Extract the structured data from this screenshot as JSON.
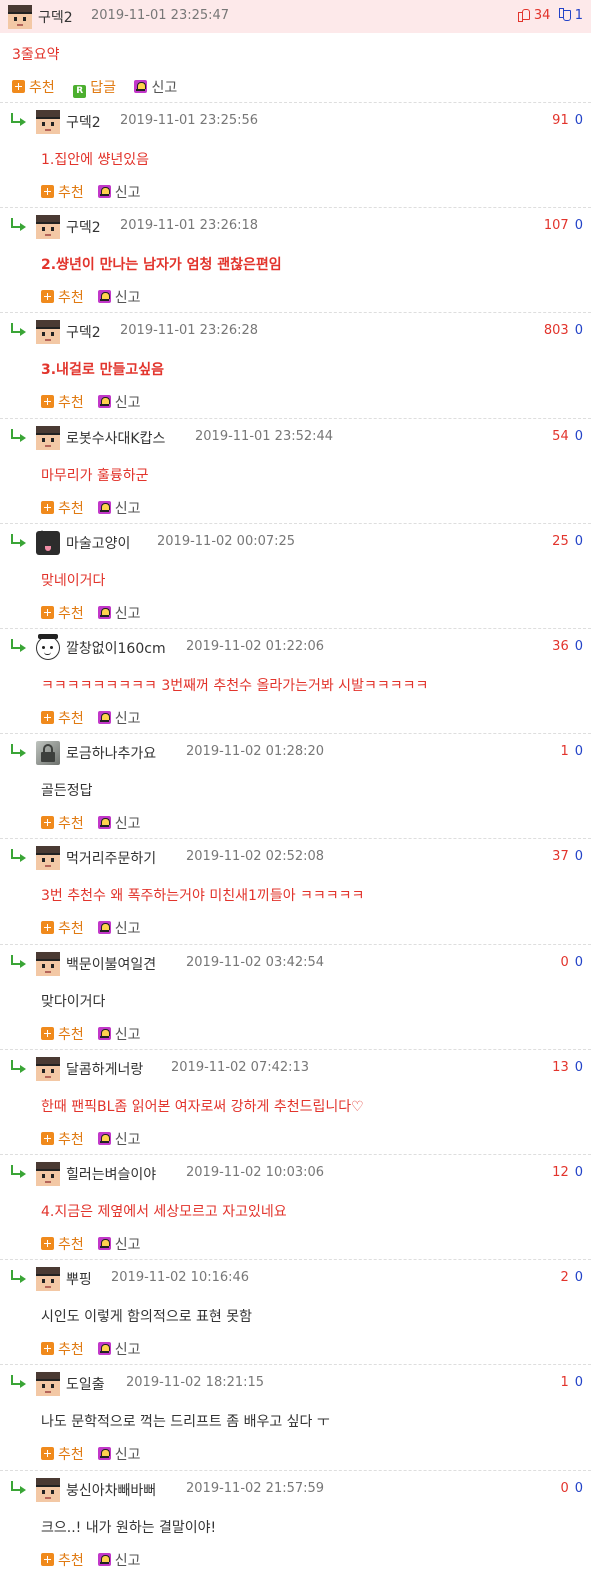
{
  "top": {
    "nick": "구덱2",
    "date": "2019-11-01 23:25:47",
    "up": "34",
    "down": "1",
    "text": "3줄요약",
    "actions": {
      "recommend": "추천",
      "reply": "답글",
      "reply_badge": "R",
      "report": "신고"
    }
  },
  "labels": {
    "recommend": "추천",
    "report": "신고"
  },
  "replies": [
    {
      "nick": "구덱2",
      "date": "2019-11-01 23:25:56",
      "up": "91",
      "down": "0",
      "text": "1.집안에 썅년있음",
      "avatar": "pixel-avatar",
      "style": "red"
    },
    {
      "nick": "구덱2",
      "date": "2019-11-01 23:26:18",
      "up": "107",
      "down": "0",
      "text": "2.썅년이 만나는 남자가 엄청 괜찮은편임",
      "avatar": "pixel-avatar",
      "style": "red-bold"
    },
    {
      "nick": "구덱2",
      "date": "2019-11-01 23:26:28",
      "up": "803",
      "down": "0",
      "text": "3.내걸로 만들고싶음",
      "avatar": "pixel-avatar",
      "style": "red-bold"
    },
    {
      "nick": "로봇수사대K캅스",
      "date": "2019-11-01 23:52:44",
      "up": "54",
      "down": "0",
      "text": "마무리가 훌륭하군",
      "avatar": "pixel-avatar",
      "style": "red"
    },
    {
      "nick": "마술고양이",
      "date": "2019-11-02 00:07:25",
      "up": "25",
      "down": "0",
      "text": "맞네이거다",
      "avatar": "cat-avatar",
      "style": "red"
    },
    {
      "nick": "깔창없이160cm",
      "date": "2019-11-02 01:22:06",
      "up": "36",
      "down": "0",
      "text": "ㅋㅋㅋㅋㅋㅋㅋㅋㅋ 3번째꺼 추천수 올라가는거봐 시발ㅋㅋㅋㅋㅋ",
      "avatar": "face-avatar",
      "style": "red"
    },
    {
      "nick": "로금하나추가요",
      "date": "2019-11-02 01:28:20",
      "up": "1",
      "down": "0",
      "text": "골든정답",
      "avatar": "lock-avatar",
      "style": "dark"
    },
    {
      "nick": "먹거리주문하기",
      "date": "2019-11-02 02:52:08",
      "up": "37",
      "down": "0",
      "text": "3번 추천수 왜 폭주하는거야 미친새1끼들아 ㅋㅋㅋㅋㅋ",
      "avatar": "pixel-avatar",
      "style": "red"
    },
    {
      "nick": "백문이불여일견",
      "date": "2019-11-02 03:42:54",
      "up": "0",
      "down": "0",
      "text": "맞다이거다",
      "avatar": "pixel-avatar",
      "style": "dark"
    },
    {
      "nick": "달콤하게너랑",
      "date": "2019-11-02 07:42:13",
      "up": "13",
      "down": "0",
      "text": "한때 팬픽BL좀 읽어본 여자로써 강하게 추천드립니다♡",
      "avatar": "pixel-avatar",
      "style": "red"
    },
    {
      "nick": "힐러는벼슬이야",
      "date": "2019-11-02 10:03:06",
      "up": "12",
      "down": "0",
      "text": "4.지금은 제옆에서 세상모르고 자고있네요",
      "avatar": "pixel-avatar",
      "style": "red"
    },
    {
      "nick": "뿌핑",
      "date": "2019-11-02 10:16:46",
      "up": "2",
      "down": "0",
      "text": "시인도 이렇게 함의적으로 표현 못함",
      "avatar": "pixel-avatar",
      "style": "dark"
    },
    {
      "nick": "도일출",
      "date": "2019-11-02 18:21:15",
      "up": "1",
      "down": "0",
      "text": "나도 문학적으로 꺽는 드리프트 좀 배우고 싶다 ㅜ",
      "avatar": "pixel-avatar",
      "style": "dark"
    },
    {
      "nick": "붕신아차빼바뻐",
      "date": "2019-11-02 21:57:59",
      "up": "0",
      "down": "0",
      "text": "크으..! 내가 원하는 결말이야!",
      "avatar": "pixel-avatar",
      "style": "dark"
    }
  ]
}
